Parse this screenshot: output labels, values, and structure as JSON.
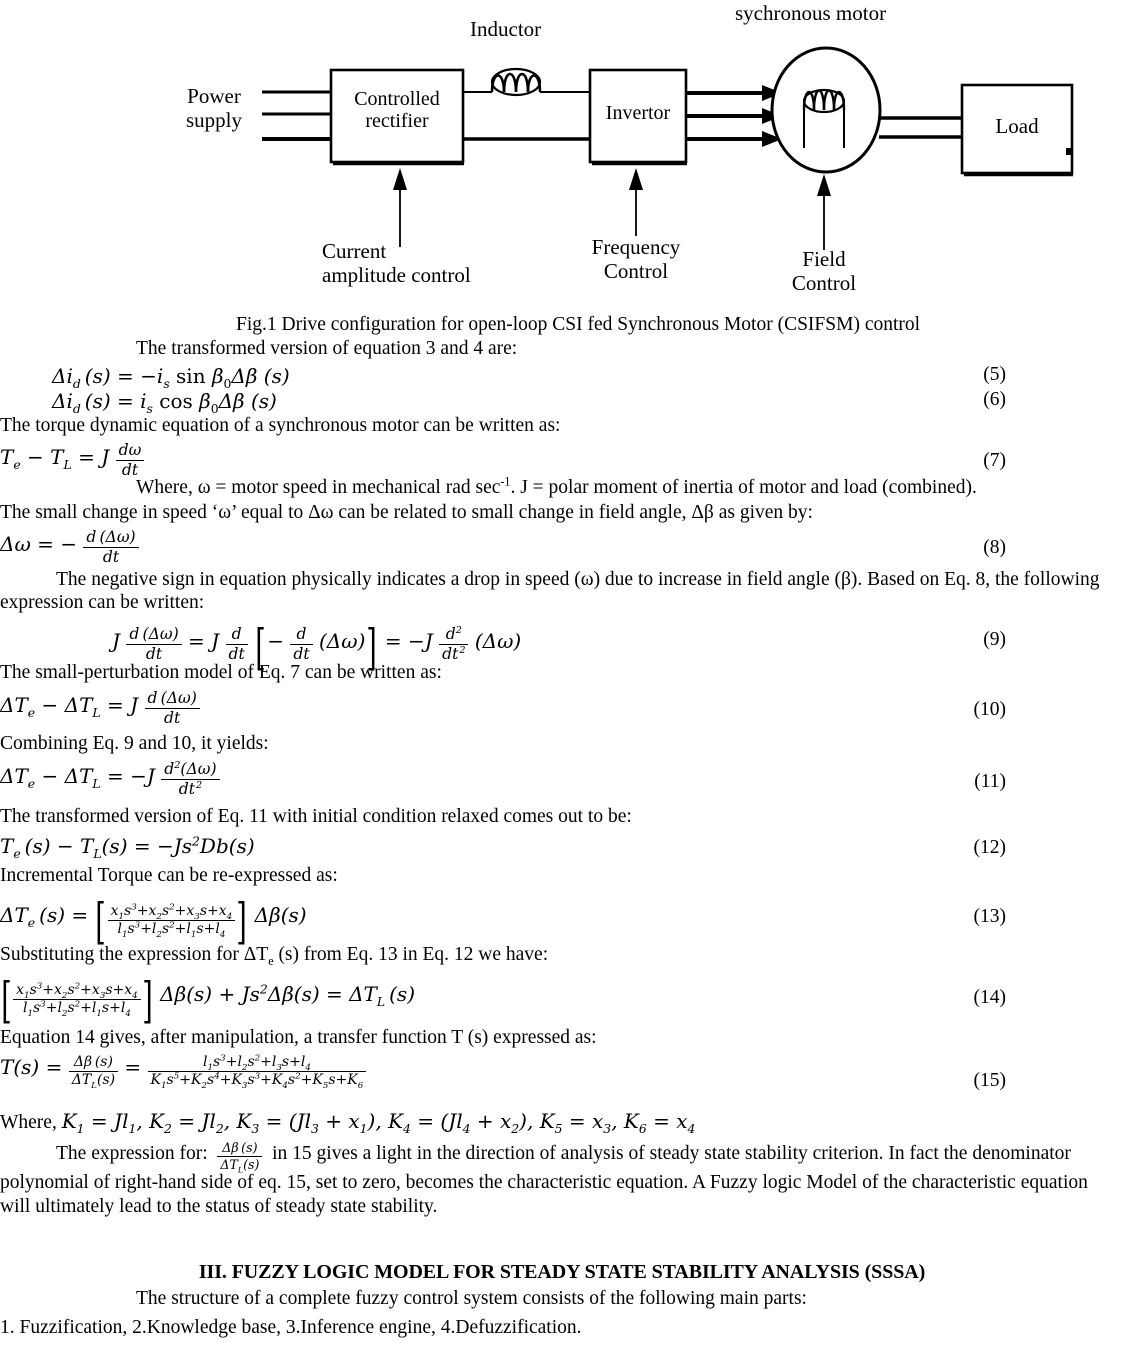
{
  "figure": {
    "labels": {
      "power_supply_l1": "Power",
      "power_supply_l2": "supply",
      "controlled_rectifier_l1": "Controlled",
      "controlled_rectifier_l2": "rectifier",
      "inductor": "Inductor",
      "invertor": "Invertor",
      "synchronous_motor": "sychronous motor",
      "load": "Load",
      "current_control_l1": "Current",
      "current_control_l2": "amplitude control",
      "frequency_control_l1": "Frequency",
      "frequency_control_l2": "Control",
      "field_control_l1": "Field",
      "field_control_l2": "Control"
    },
    "caption": "Fig.1 Drive configuration for open-loop CSI fed Synchronous Motor (CSIFSM) control"
  },
  "text": {
    "intro_eq34": "The transformed version of equation 3 and 4 are:",
    "torque_dynamic": "The torque dynamic equation of a synchronous motor can be written as:",
    "where_omega": "Where, ω = motor speed in mechanical rad sec",
    "where_omega_sup": "-1",
    "where_omega_rest": ". J = polar moment of inertia of motor and load (combined).",
    "small_change": "The small change in speed ‘ω’ equal to Δω can be related to small change in field angle, Δβ as given by:",
    "negative_sign_p1": "The negative sign in equation physically indicates a drop in speed (ω) due to increase in field angle (β). Based on Eq. 8, the following expression can be written:",
    "small_perturbation": "The small-perturbation model of Eq. 7 can be written as:",
    "combining": "Combining Eq. 9 and 10, it yields:",
    "transformed_11": "The transformed version of Eq. 11 with initial condition relaxed comes out to be:",
    "incremental_torque": "Incremental Torque can be re-expressed as:",
    "substituting_pre": "Substituting the expression for ΔT",
    "substituting_sub": "e",
    "substituting_post": " (s) from Eq. 13 in Eq. 12 we have:",
    "equation14_intro": "Equation 14 gives, after manipulation, a transfer function T (s) expressed as:",
    "where_k_label": "Where,",
    "expression_for_pre": "The expression for:",
    "expression_for_post": "in 15 gives a light in the direction of analysis of steady state stability criterion. In fact the denominator polynomial of right-hand side of eq. 15, set to zero, becomes the characteristic equation. A Fuzzy logic Model of the characteristic equation will ultimately lead to the status of steady state stability.",
    "section_heading": "III. FUZZY LOGIC MODEL FOR STEADY STATE STABILITY ANALYSIS (SSSA)",
    "structure_line": "The structure of a complete fuzzy control system consists of the following main parts:",
    "parts_line": "1. Fuzzification, 2.Knowledge base, 3.Inference engine, 4.Defuzzification."
  },
  "equations": {
    "n5": "(5)",
    "n6": "(6)",
    "n7": "(7)",
    "n8": "(8)",
    "n9": "(9)",
    "n10": "(10)",
    "n11": "(11)",
    "n12": "(12)",
    "n13": "(13)",
    "n14": "(14)",
    "n15": "(15)"
  },
  "colors": {
    "ink": "#000000",
    "page": "#ffffff"
  }
}
